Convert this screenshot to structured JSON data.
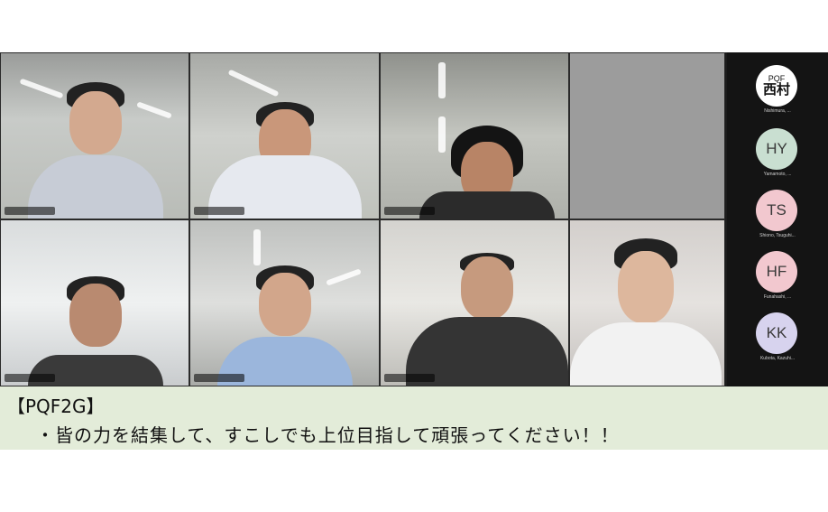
{
  "sidebar": {
    "participants": [
      {
        "line1": "PQF",
        "line2": "西村",
        "name": "Nishimura, ...",
        "color": "#ffffff"
      },
      {
        "initials": "HY",
        "name": "Yamamoto, ...",
        "color": "#c9dfd1"
      },
      {
        "initials": "TS",
        "name": "Shiono, Tsuguhi...",
        "color": "#f2c8cf"
      },
      {
        "initials": "HF",
        "name": "Funahashi, ...",
        "color": "#f2c8cf"
      },
      {
        "initials": "KK",
        "name": "Kubota, Kazuhi...",
        "color": "#d7d3ee"
      }
    ]
  },
  "caption": {
    "title": "【PQF2G】",
    "message": "・皆の力を結集して、すこしでも上位目指して頑張ってください！！"
  }
}
